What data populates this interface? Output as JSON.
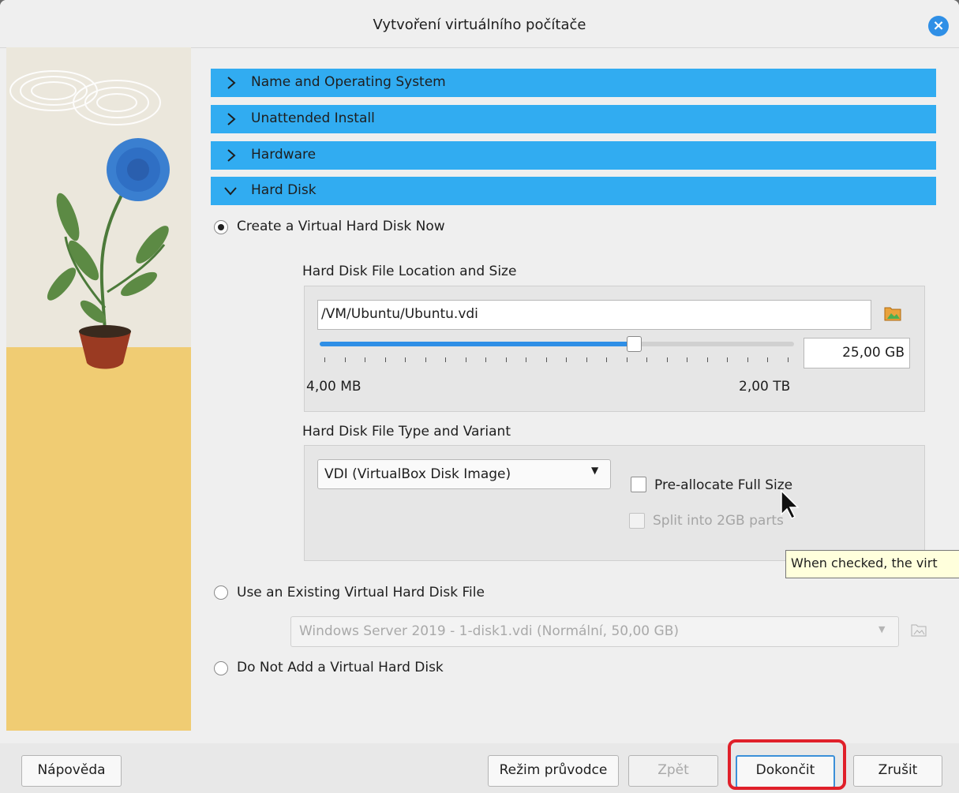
{
  "window": {
    "title": "Vytvoření virtuálního počítače"
  },
  "sections": [
    {
      "label": "Name and Operating System",
      "expanded": false
    },
    {
      "label": "Unattended Install",
      "expanded": false
    },
    {
      "label": "Hardware",
      "expanded": false
    },
    {
      "label": "Hard Disk",
      "expanded": true
    }
  ],
  "hard_disk": {
    "option_create": {
      "label": "Create a Virtual Hard Disk Now",
      "selected": true
    },
    "location_group": {
      "title": "Hard Disk File Location and Size",
      "path": "/VM/Ubuntu/Ubuntu.vdi",
      "size_value": "25,00 GB",
      "slider_fraction": 0.66,
      "min_label": "4,00 MB",
      "max_label": "2,00 TB"
    },
    "type_group": {
      "title": "Hard Disk File Type and Variant",
      "format": "VDI (VirtualBox Disk Image)",
      "preallocate_label": "Pre-allocate Full Size",
      "preallocate_checked": false,
      "split_label": "Split into 2GB parts",
      "split_enabled": false
    },
    "option_existing": {
      "label": "Use an Existing Virtual Hard Disk File",
      "selected": false
    },
    "existing_file": "Windows Server 2019 - 1-disk1.vdi (Normální, 50,00 GB)",
    "option_none": {
      "label": "Do Not Add a Virtual Hard Disk",
      "selected": false
    }
  },
  "tooltip": "When checked, the virt",
  "buttons": {
    "help": "Nápověda",
    "guided_mode": "Režim průvodce",
    "back": "Zpět",
    "finish": "Dokončit",
    "cancel": "Zrušit"
  },
  "colors": {
    "section_bar": "#31acf1",
    "highlight_ring": "#e0202a",
    "accent": "#2f8fe6"
  }
}
